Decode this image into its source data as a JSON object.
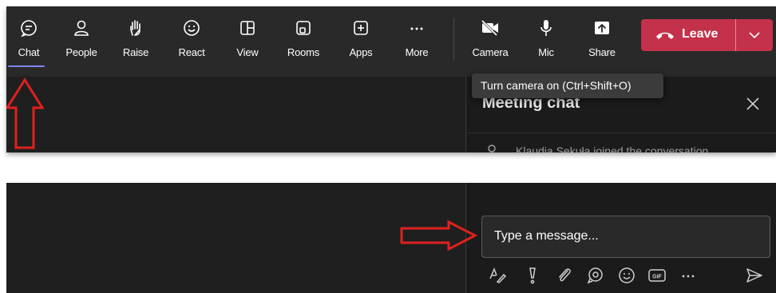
{
  "toolbar": {
    "buttons": [
      {
        "label": "Chat",
        "icon": "chat-icon"
      },
      {
        "label": "People",
        "icon": "people-icon"
      },
      {
        "label": "Raise",
        "icon": "raise-hand-icon"
      },
      {
        "label": "React",
        "icon": "smiley-icon"
      },
      {
        "label": "View",
        "icon": "view-grid-icon"
      },
      {
        "label": "Rooms",
        "icon": "rooms-icon"
      },
      {
        "label": "Apps",
        "icon": "apps-plus-icon"
      },
      {
        "label": "More",
        "icon": "more-dots-icon"
      },
      {
        "label": "Camera",
        "icon": "camera-off-icon"
      },
      {
        "label": "Mic",
        "icon": "mic-icon"
      },
      {
        "label": "Share",
        "icon": "share-icon"
      }
    ],
    "leave_label": "Leave"
  },
  "tooltip": {
    "text": "Turn camera on (Ctrl+Shift+O)"
  },
  "chat_pane": {
    "title": "Meeting chat",
    "system_message": "Klaudia Sekuła joined the conversation."
  },
  "compose": {
    "placeholder": "Type a message...",
    "tools": [
      "format-icon",
      "important-icon",
      "attach-icon",
      "loop-icon",
      "emoji-icon",
      "gif-icon",
      "more-icon",
      "send-icon"
    ]
  },
  "colors": {
    "leave": "#c4314b",
    "accent": "#7f85f5",
    "annotation": "#e02020",
    "background": "#1f1f1f"
  }
}
